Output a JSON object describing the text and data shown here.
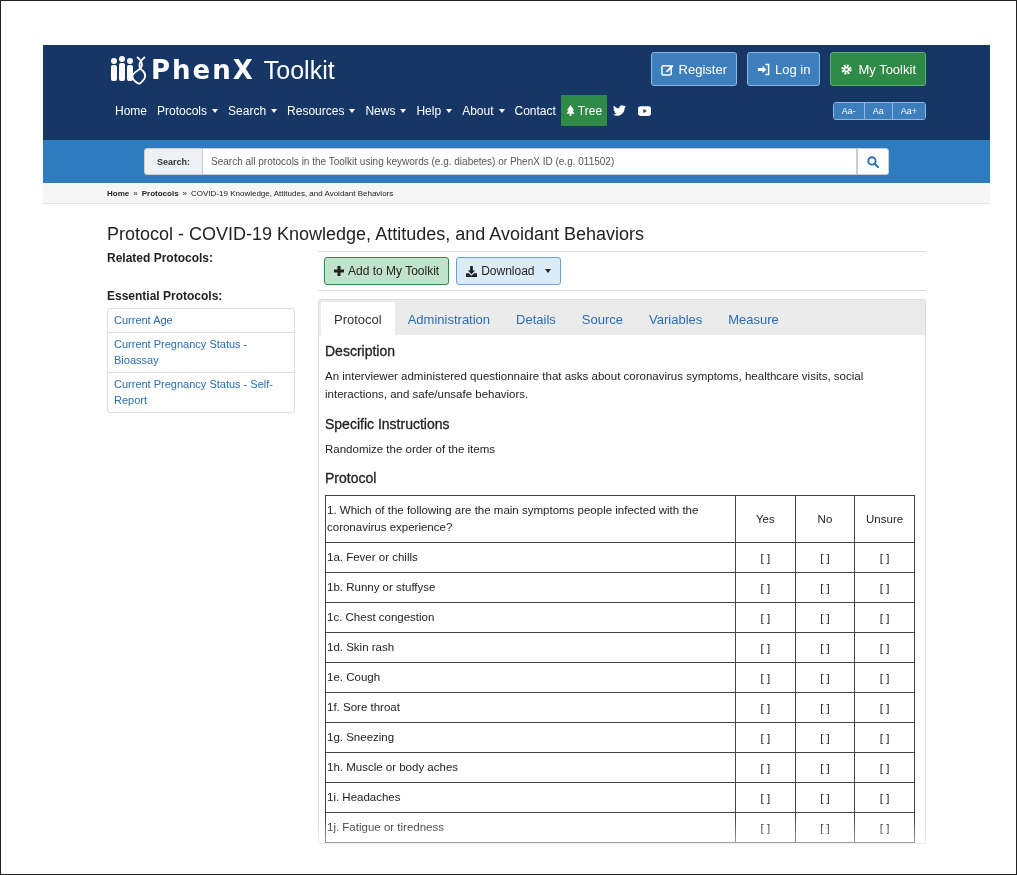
{
  "header": {
    "logo": {
      "brand": "PhenX",
      "product": "Toolkit"
    },
    "account_buttons": [
      {
        "label": "Register",
        "kind": "register"
      },
      {
        "label": "Log in",
        "kind": "login"
      },
      {
        "label": "My Toolkit",
        "kind": "toolkit"
      }
    ],
    "nav": [
      {
        "label": "Home",
        "kind": "link",
        "dropdown": false,
        "selected": false
      },
      {
        "label": "Protocols",
        "kind": "link",
        "dropdown": true,
        "selected": false
      },
      {
        "label": "Search",
        "kind": "link",
        "dropdown": true,
        "selected": false
      },
      {
        "label": "Resources",
        "kind": "link",
        "dropdown": true,
        "selected": false
      },
      {
        "label": "News",
        "kind": "link",
        "dropdown": true,
        "selected": false
      },
      {
        "label": "Help",
        "kind": "link",
        "dropdown": true,
        "selected": false
      },
      {
        "label": "About",
        "kind": "link",
        "dropdown": true,
        "selected": false
      },
      {
        "label": "Contact",
        "kind": "link",
        "dropdown": false,
        "selected": false
      },
      {
        "label": "Tree",
        "kind": "tree",
        "dropdown": false,
        "selected": true
      },
      {
        "kind": "twitter"
      },
      {
        "kind": "youtube"
      }
    ],
    "font_size_buttons": [
      "Aa-",
      "Aa",
      "Aa+"
    ]
  },
  "search": {
    "label": "Search:",
    "placeholder": "Search all protocols in the Toolkit using keywords (e.g. diabetes) or PhenX ID (e.g. 011502)"
  },
  "breadcrumb": [
    "Home",
    "Protocols",
    "COVID-19 Knowledge, Attitudes, and Avoidant Behaviors"
  ],
  "breadcrumb_separator": "»",
  "page_title": "Protocol - COVID-19 Knowledge, Attitudes, and Avoidant Behaviors",
  "sidebar": {
    "related_heading": "Related Protocols:",
    "essential_heading": "Essential Protocols:",
    "essential_items": [
      "Current Age",
      "Current Pregnancy Status - Bioassay",
      "Current Pregnancy Status - Self-Report"
    ]
  },
  "actions": [
    {
      "label": "Add to My Toolkit",
      "kind": "add",
      "dropdown": false
    },
    {
      "label": "Download",
      "kind": "download",
      "dropdown": true
    }
  ],
  "tabs": [
    {
      "label": "Protocol",
      "selected": true
    },
    {
      "label": "Administration",
      "selected": false
    },
    {
      "label": "Details",
      "selected": false
    },
    {
      "label": "Source",
      "selected": false
    },
    {
      "label": "Variables",
      "selected": false
    },
    {
      "label": "Measure",
      "selected": false
    }
  ],
  "sections": [
    {
      "heading": "Description",
      "text": "An interviewer administered questionnaire that asks about coronavirus symptoms, healthcare visits, social interactions, and safe/unsafe behaviors."
    },
    {
      "heading": "Specific Instructions",
      "text": "Randomize the order of the items"
    },
    {
      "heading": "Protocol"
    }
  ],
  "table": {
    "columns": [
      "1. Which of the following are the main symptoms people infected with the coronavirus experience?",
      "Yes",
      "No",
      "Unsure"
    ],
    "rows": [
      {
        "item": "1a. Fever or chills",
        "answers": [
          "[ ]",
          "[ ]",
          "[ ]"
        ]
      },
      {
        "item": "1b. Runny or stuffyse",
        "answers": [
          "[ ]",
          "[ ]",
          "[ ]"
        ]
      },
      {
        "item": "1c. Chest congestion",
        "answers": [
          "[ ]",
          "[ ]",
          "[ ]"
        ]
      },
      {
        "item": "1d. Skin rash",
        "answers": [
          "[ ]",
          "[ ]",
          "[ ]"
        ]
      },
      {
        "item": "1e. Cough",
        "answers": [
          "[ ]",
          "[ ]",
          "[ ]"
        ]
      },
      {
        "item": "1f. Sore throat",
        "answers": [
          "[ ]",
          "[ ]",
          "[ ]"
        ]
      },
      {
        "item": "1g. Sneezing",
        "answers": [
          "[ ]",
          "[ ]",
          "[ ]"
        ]
      },
      {
        "item": "1h. Muscle or body aches",
        "answers": [
          "[ ]",
          "[ ]",
          "[ ]"
        ]
      },
      {
        "item": "1i. Headaches",
        "answers": [
          "[ ]",
          "[ ]",
          "[ ]"
        ]
      },
      {
        "item": "1j. Fatigue or tiredness",
        "answers": [
          "[ ]",
          "[ ]",
          "[ ]"
        ]
      }
    ]
  }
}
